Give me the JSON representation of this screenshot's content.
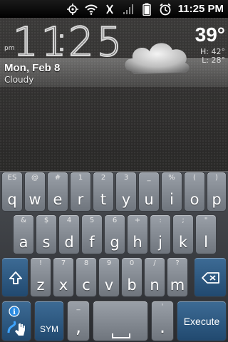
{
  "status_bar": {
    "icons": [
      "gps-icon",
      "wifi-icon",
      "no-signal-icon",
      "signal-bars-icon",
      "battery-icon",
      "alarm-icon"
    ],
    "time": "11:25 PM"
  },
  "widget": {
    "ampm": "pm",
    "hours": "11",
    "minutes": "25",
    "date": "Mon, Feb 8",
    "condition": "Cloudy",
    "temperature": "39°",
    "high": "H: 42°",
    "low": "L: 28°"
  },
  "keyboard": {
    "row1": [
      {
        "alt": "ES",
        "main": "q"
      },
      {
        "alt": "@",
        "main": "w"
      },
      {
        "alt": "#",
        "main": "e"
      },
      {
        "alt": "1",
        "main": "r"
      },
      {
        "alt": "2",
        "main": "t"
      },
      {
        "alt": "3",
        "main": "y"
      },
      {
        "alt": "_",
        "main": "u"
      },
      {
        "alt": "%",
        "main": "i"
      },
      {
        "alt": "(",
        "main": "o"
      },
      {
        "alt": ")",
        "main": "p"
      }
    ],
    "row2": [
      {
        "alt": "&",
        "main": "a"
      },
      {
        "alt": "$",
        "main": "s"
      },
      {
        "alt": "4",
        "main": "d"
      },
      {
        "alt": "5",
        "main": "f"
      },
      {
        "alt": "6",
        "main": "g"
      },
      {
        "alt": "+",
        "main": "h"
      },
      {
        "alt": ":",
        "main": "j"
      },
      {
        "alt": ";",
        "main": "k"
      },
      {
        "alt": "\"",
        "main": "l"
      }
    ],
    "row3": [
      {
        "alt": "!",
        "main": "z"
      },
      {
        "alt": "7",
        "main": "x"
      },
      {
        "alt": "8",
        "main": "c"
      },
      {
        "alt": "9",
        "main": "v"
      },
      {
        "alt": "0",
        "main": "b"
      },
      {
        "alt": "/",
        "main": "n"
      },
      {
        "alt": "?",
        "main": "m"
      }
    ],
    "shift_icon": "shift-arrow-icon",
    "backspace_icon": "backspace-icon",
    "info_icon": "info-swype-icon",
    "sym_label": "SYM",
    "comma": {
      "alt": "_",
      "main": ","
    },
    "period": {
      "alt": "'",
      "main": "."
    },
    "space_icon": "space-bar-icon",
    "execute_label": "Execute",
    "trail_color": "#3b8fd6"
  }
}
